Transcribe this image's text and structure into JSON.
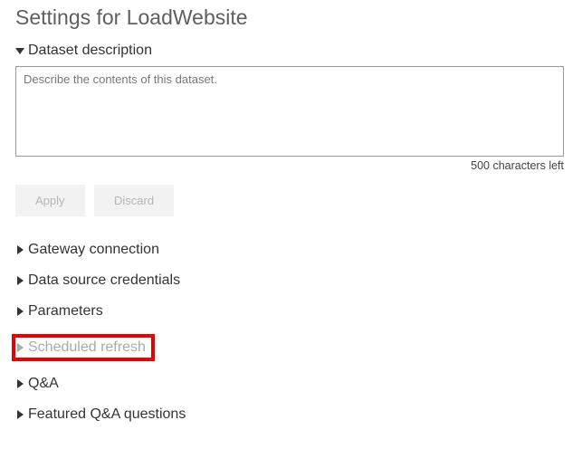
{
  "title": "Settings for LoadWebsite",
  "description_section": {
    "label": "Dataset description",
    "placeholder": "Describe the contents of this dataset.",
    "value": "",
    "counter_text": "500 characters left"
  },
  "buttons": {
    "apply": "Apply",
    "discard": "Discard"
  },
  "sections": {
    "gateway": "Gateway connection",
    "credentials": "Data source credentials",
    "parameters": "Parameters",
    "scheduled_refresh": "Scheduled refresh",
    "qna": "Q&A",
    "featured_qna": "Featured Q&A questions"
  }
}
